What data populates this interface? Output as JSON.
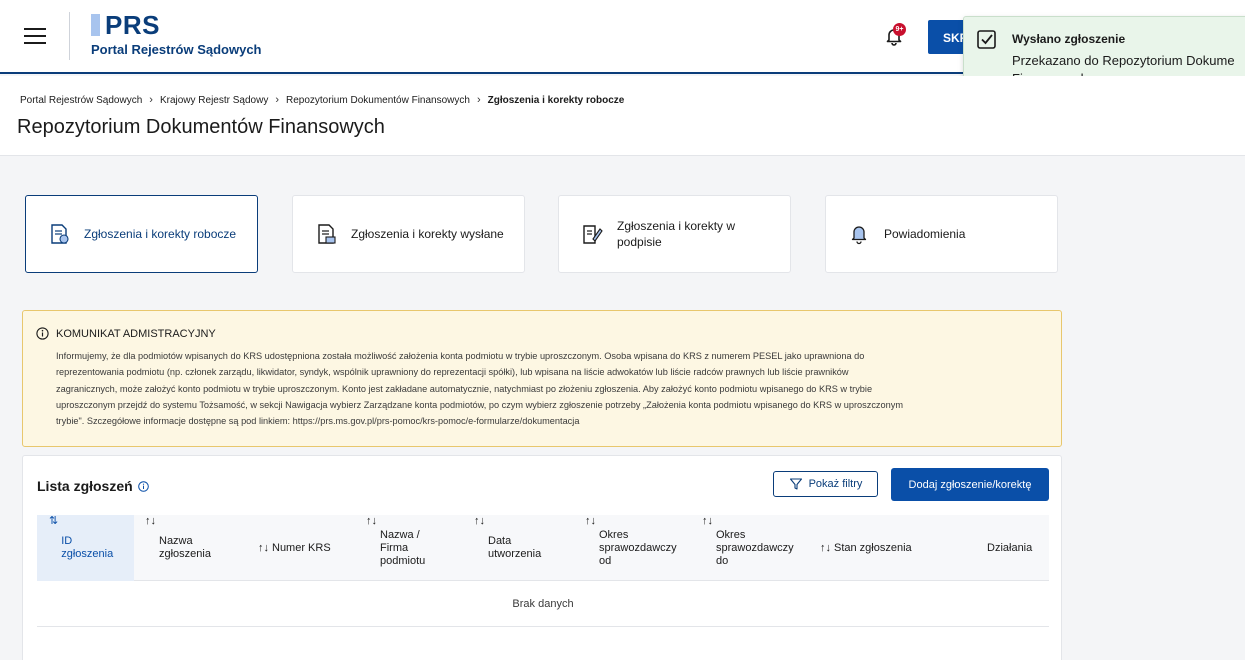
{
  "header": {
    "logo_text": "PRS",
    "logo_subtitle": "Portal Rejestrów Sądowych",
    "notification_badge": "9+",
    "skip_button_label": "SKR"
  },
  "toast": {
    "title": "Wysłano zgłoszenie",
    "message_line1": "Przekazano do Repozytorium Dokume",
    "message_line2": "Finansowych."
  },
  "breadcrumb": [
    "Portal Rejestrów Sądowych",
    "Krajowy Rejestr Sądowy",
    "Repozytorium Dokumentów Finansowych",
    "Zgłoszenia i korekty robocze"
  ],
  "page_title": "Repozytorium Dokumentów Finansowych",
  "tiles": [
    {
      "label": "Zgłoszenia i korekty robocze",
      "icon": "draft-document-icon",
      "active": true
    },
    {
      "label": "Zgłoszenia i korekty wysłane",
      "icon": "sent-document-icon",
      "active": false
    },
    {
      "label_line1": "Zgłoszenia i korekty w",
      "label_line2": "podpisie",
      "icon": "signature-document-icon",
      "active": false
    },
    {
      "label": "Powiadomienia",
      "icon": "bell-icon",
      "active": false
    }
  ],
  "notice": {
    "title": "KOMUNIKAT ADMISTRACYJNY",
    "lines": [
      "Informujemy, że dla podmiotów wpisanych do KRS udostępniona została możliwość założenia konta podmiotu w trybie uproszczonym. Osoba wpisana do KRS z numerem PESEL jako uprawniona do",
      "reprezentowania podmiotu (np. członek zarządu, likwidator, syndyk, wspólnik uprawniony do reprezentacji spółki), lub wpisana na liście adwokatów lub liście radców prawnych lub liście prawników",
      "zagranicznych, może założyć konto podmiotu w trybie uproszczonym. Konto jest zakładane automatycznie, natychmiast po złożeniu zgłoszenia. Aby założyć konto podmiotu wpisanego do KRS w trybie",
      "uproszczonym przejdź do systemu Tożsamość, w sekcji Nawigacja wybierz Zarządzane konta podmiotów, po czym wybierz zgłoszenie potrzeby „Założenia konta podmiotu wpisanego do KRS w uproszczonym",
      "trybie\". Szczegółowe informacje dostępne są pod linkiem: https://prs.ms.gov.pl/prs-pomoc/krs-pomoc/e-formularze/dokumentacja"
    ]
  },
  "list": {
    "title": "Lista zgłoszeń",
    "filter_button": "Pokaż filtry",
    "add_button": "Dodaj zgłoszenie/korektę",
    "columns": [
      {
        "sort": "⇅",
        "lines": [
          "ID",
          "zgłoszenia"
        ]
      },
      {
        "sort": "↑↓",
        "lines": [
          "Nazwa",
          "zgłoszenia"
        ]
      },
      {
        "sort": "↑↓",
        "lines": [
          "Numer KRS"
        ]
      },
      {
        "sort": "↑↓",
        "lines": [
          "Nazwa /",
          "Firma",
          "podmiotu"
        ]
      },
      {
        "sort": "↑↓",
        "lines": [
          "Data",
          "utworzenia"
        ]
      },
      {
        "sort": "↑↓",
        "lines": [
          "Okres",
          "sprawozdawczy",
          "od"
        ]
      },
      {
        "sort": "↑↓",
        "lines": [
          "Okres",
          "sprawozdawczy",
          "do"
        ]
      },
      {
        "sort": "↑↓",
        "lines": [
          "Stan zgłoszenia"
        ]
      },
      {
        "sort": "",
        "lines": [
          "Działania"
        ]
      }
    ],
    "empty_text": "Brak danych"
  },
  "colors": {
    "primary": "#0a4fa8",
    "brand_dark": "#0a3d7a",
    "toast_bg": "#e9f5ea",
    "notice_bg": "#fdf7e3",
    "notice_border": "#e8c76d",
    "badge": "#c8102e"
  }
}
